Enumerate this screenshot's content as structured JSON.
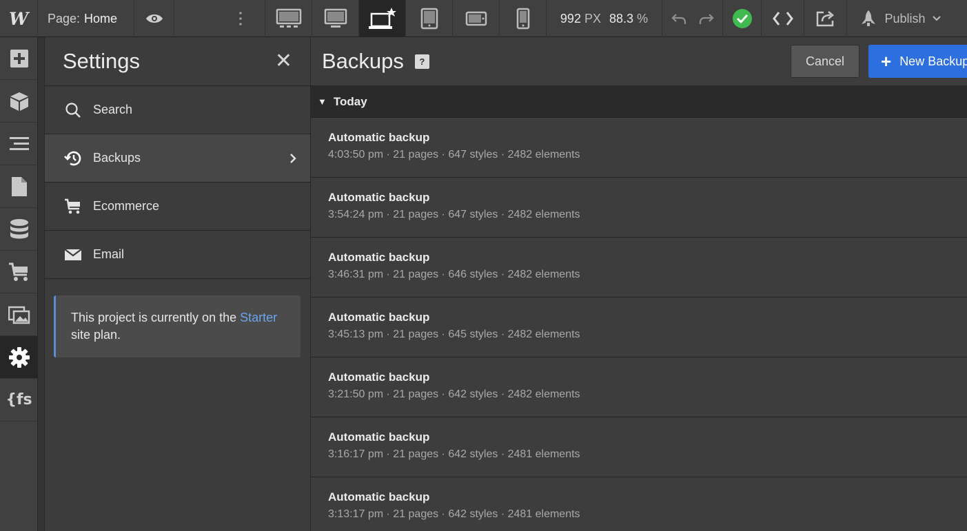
{
  "topbar": {
    "logo": "W",
    "page_label": "Page:",
    "page_name": "Home",
    "width_value": "992",
    "width_unit": "PX",
    "zoom_value": "88.3",
    "zoom_unit": "%",
    "publish_label": "Publish",
    "active_device": "desktop-base"
  },
  "rail": {
    "items": [
      {
        "name": "add-icon",
        "active": false
      },
      {
        "name": "symbols-icon",
        "active": false
      },
      {
        "name": "navigator-icon",
        "active": false
      },
      {
        "name": "pages-icon",
        "active": false
      },
      {
        "name": "cms-icon",
        "active": false
      },
      {
        "name": "ecommerce-icon",
        "active": false
      },
      {
        "name": "assets-icon",
        "active": false
      },
      {
        "name": "settings-gear-icon",
        "active": true
      },
      {
        "name": "finsweet-icon",
        "active": false,
        "text": "{fs"
      }
    ]
  },
  "settings": {
    "title": "Settings",
    "nav": [
      {
        "label": "Search",
        "icon": "search-icon"
      },
      {
        "label": "Backups",
        "icon": "history-icon",
        "active": true
      },
      {
        "label": "Ecommerce",
        "icon": "cart-icon"
      },
      {
        "label": "Email",
        "icon": "envelope-icon"
      }
    ],
    "plan_text_before": "This project is currently on the",
    "plan_link": "Starter",
    "plan_text_after": "site plan."
  },
  "backups": {
    "title": "Backups",
    "help": "?",
    "cancel_label": "Cancel",
    "new_label": "New Backup",
    "section": "Today",
    "items": [
      {
        "title": "Automatic backup",
        "meta": "4:03:50 pm · 21 pages · 647 styles · 2482 elements"
      },
      {
        "title": "Automatic backup",
        "meta": "3:54:24 pm · 21 pages · 647 styles · 2482 elements"
      },
      {
        "title": "Automatic backup",
        "meta": "3:46:31 pm · 21 pages · 646 styles · 2482 elements"
      },
      {
        "title": "Automatic backup",
        "meta": "3:45:13 pm · 21 pages · 645 styles · 2482 elements"
      },
      {
        "title": "Automatic backup",
        "meta": "3:21:50 pm · 21 pages · 642 styles · 2482 elements"
      },
      {
        "title": "Automatic backup",
        "meta": "3:16:17 pm · 21 pages · 642 styles · 2481 elements"
      },
      {
        "title": "Automatic backup",
        "meta": "3:13:17 pm · 21 pages · 642 styles · 2481 elements"
      }
    ]
  },
  "colors": {
    "accent": "#2e6fe0",
    "link": "#6aa5ef",
    "success": "#3fb950"
  }
}
